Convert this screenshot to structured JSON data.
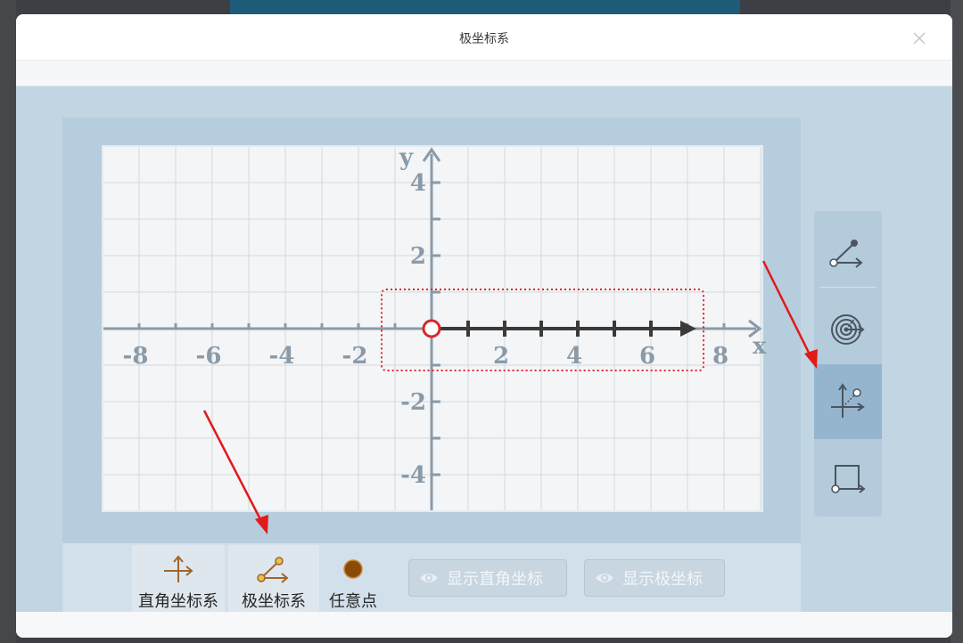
{
  "window": {
    "title": "极坐标系"
  },
  "graph": {
    "x_axis_label": "x",
    "y_axis_label": "y",
    "x_tick_labels": [
      "-8",
      "-6",
      "-4",
      "-2",
      "2",
      "4",
      "6",
      "8"
    ],
    "y_tick_labels": [
      "4",
      "2",
      "-2",
      "-4"
    ],
    "axis_color": "#8a9aa8",
    "polar_axis_color": "#3a3a3a",
    "pole_color": "#d9262b",
    "highlight_color": "#e0262b"
  },
  "toolbar": {
    "cartesian_label": "直角坐标系",
    "polar_label": "极坐标系",
    "point_label": "任意点",
    "show_cartesian_label": "显示直角坐标",
    "show_polar_label": "显示极坐标"
  },
  "side_tools": [
    {
      "name": "angle-tool-icon"
    },
    {
      "name": "radar-tool-icon"
    },
    {
      "name": "axes-point-tool-icon",
      "active": true
    },
    {
      "name": "rectangle-tool-icon"
    }
  ],
  "colors": {
    "workspace_bg": "#c2d5e3",
    "annotation_arrow": "#e21a1a",
    "point_fill": "#8a4a08"
  }
}
